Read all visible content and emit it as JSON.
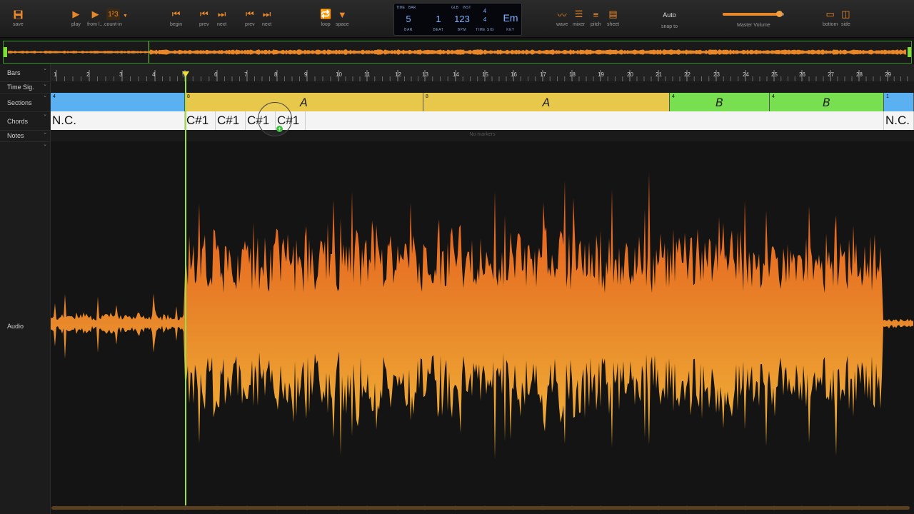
{
  "toolbar": {
    "save": "save",
    "play": "play",
    "from": "from l...",
    "countin_glyph": "1²3",
    "countin": "count-in",
    "begin": "begin",
    "prev1": "prev",
    "next1": "next",
    "prev2": "prev",
    "next2": "next",
    "loop": "loop",
    "space": "space",
    "wave": "wave",
    "mixer": "mixer",
    "pitch": "pitch",
    "sheet": "sheet",
    "snap_value": "Auto",
    "snap_label": "snap to",
    "master_volume": "Master Volume",
    "bottom": "bottom",
    "side": "side",
    "volume_level": 0.92
  },
  "lcd": {
    "time_top": "TIME",
    "bar_top": "BAR",
    "bar": "5",
    "bar_label": "BAR",
    "beat": "1",
    "beat_label": "BEAT",
    "glb_top": "GLB",
    "inst_top": "INST",
    "bpm": "123",
    "bpm_label": "BPM",
    "ts_num": "4",
    "ts_den": "4",
    "ts_label": "TIME SIG",
    "key": "Em",
    "key_label": "KEY"
  },
  "tracks": {
    "bars": "Bars",
    "timesig": "Time Sig.",
    "sections": "Sections",
    "chords": "Chords",
    "notes": "Notes",
    "audio": "Audio"
  },
  "ruler": [
    "1",
    "2",
    "3",
    "4",
    "5",
    "6",
    "7",
    "8",
    "9",
    "10",
    "11",
    "12",
    "13",
    "14",
    "15",
    "16",
    "17",
    "18",
    "19",
    "20",
    "21",
    "22",
    "23",
    "24",
    "25",
    "26",
    "27",
    "28",
    "29"
  ],
  "sections": [
    {
      "num": "4",
      "label": "",
      "color": "#5ab0f0"
    },
    {
      "num": "8",
      "label": "A",
      "color": "#e8c84a"
    },
    {
      "num": "8",
      "label": "A",
      "color": "#e8c84a"
    },
    {
      "num": "4",
      "label": "B",
      "color": "#78e050"
    },
    {
      "num": "4",
      "label": "B",
      "color": "#78e050"
    },
    {
      "num": "1",
      "label": "",
      "color": "#5ab0f0"
    }
  ],
  "chords": [
    "N.C.",
    "C#1",
    "C#1",
    "C#1",
    "C#1",
    "",
    "N.C."
  ],
  "notes_empty": "No markers",
  "colors": {
    "accent": "#e8862a",
    "waveform_top": "#e86a1a",
    "waveform_bottom": "#f0b030",
    "playhead": "#9be04a"
  }
}
